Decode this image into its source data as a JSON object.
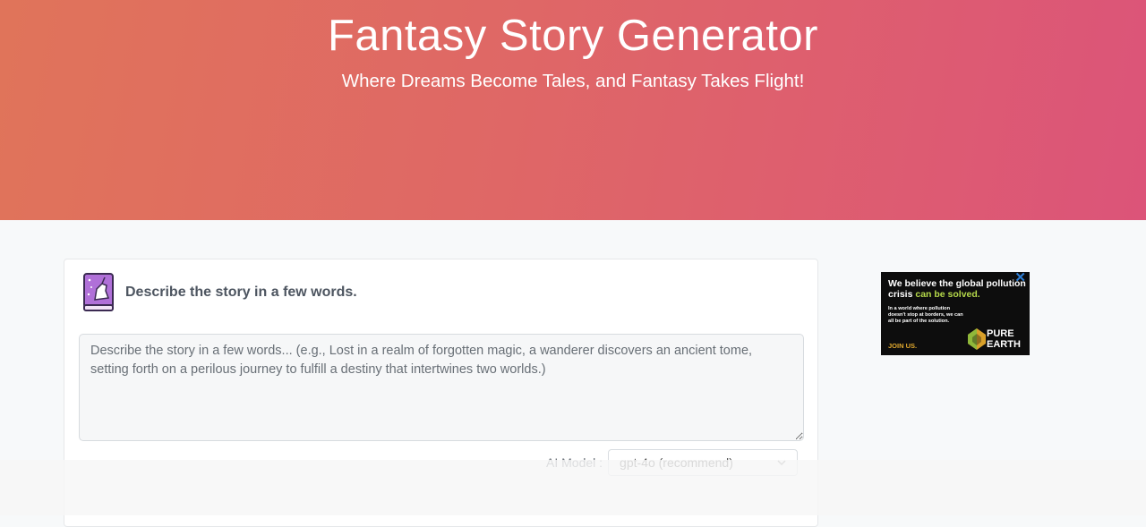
{
  "hero": {
    "title": "Fantasy Story Generator",
    "subtitle": "Where Dreams Become Tales, and Fantasy Takes Flight!"
  },
  "form": {
    "icon": "book-icon",
    "heading": "Describe the story in a few words.",
    "story_placeholder": "Describe the story in a few words... (e.g., Lost in a realm of forgotten magic, a wanderer discovers an ancient tome, setting forth on a perilous journey to fulfill a destiny that intertwines two worlds.)",
    "story_value": "",
    "model_label": "AI Model :",
    "model_selected": "gpt-4o (recommend)"
  },
  "ad": {
    "close_glyph": "✕",
    "headline_part1": "We believe the global pollution crisis ",
    "headline_highlight": "can be solved.",
    "body": "In a world where pollution doesn't stop at borders, we can all be part of the solution.",
    "cta": "JOIN US.",
    "brand_line1": "PURE",
    "brand_line2": "EARTH"
  },
  "colors": {
    "hero_start": "#e0745a",
    "hero_end": "#dc5479",
    "ad_highlight": "#b5d94a",
    "ad_cta": "#e0a82e",
    "ad_close": "#2e7fd6"
  }
}
